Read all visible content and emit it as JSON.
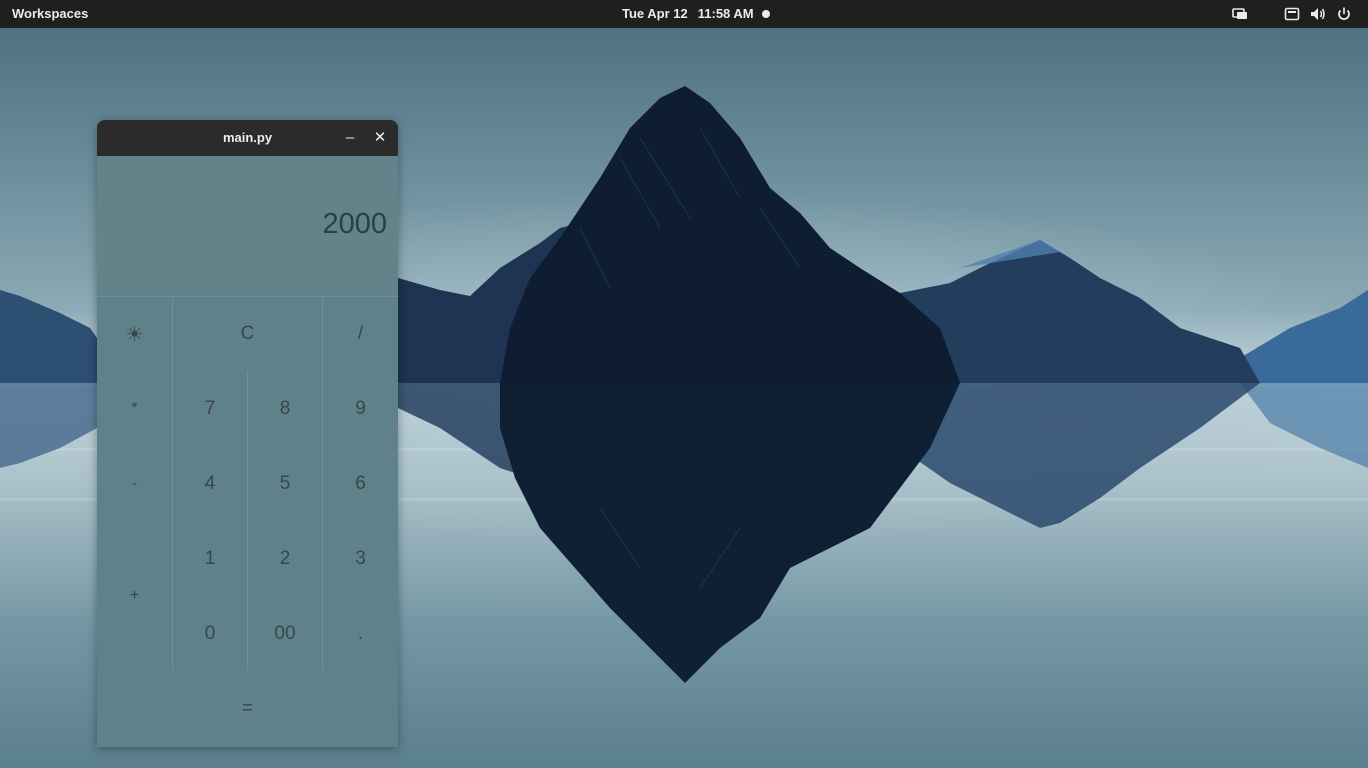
{
  "topbar": {
    "workspaces": "Workspaces",
    "date": "Tue Apr 12",
    "time": "11:58 AM",
    "icons": [
      "screen-share-icon",
      "keyboard-icon",
      "volume-icon",
      "power-icon"
    ]
  },
  "window": {
    "title": "main.py",
    "minimize_label": "–",
    "close_label": "✕"
  },
  "calculator": {
    "display": "2000",
    "keys": {
      "theme": "☀",
      "clear": "C",
      "divide": "/",
      "multiply": "*",
      "seven": "7",
      "eight": "8",
      "nine": "9",
      "minus": "-",
      "four": "4",
      "five": "5",
      "six": "6",
      "plus": "+",
      "one": "1",
      "two": "2",
      "three": "3",
      "zero": "0",
      "double_zero": "00",
      "decimal": ".",
      "equals": "="
    }
  },
  "colors": {
    "topbar": "#1f1f1f",
    "window_titlebar": "#2b2b2b",
    "calc_background": "#5f828a",
    "key_text": "#38464a",
    "mountain": "#0e1d31"
  }
}
